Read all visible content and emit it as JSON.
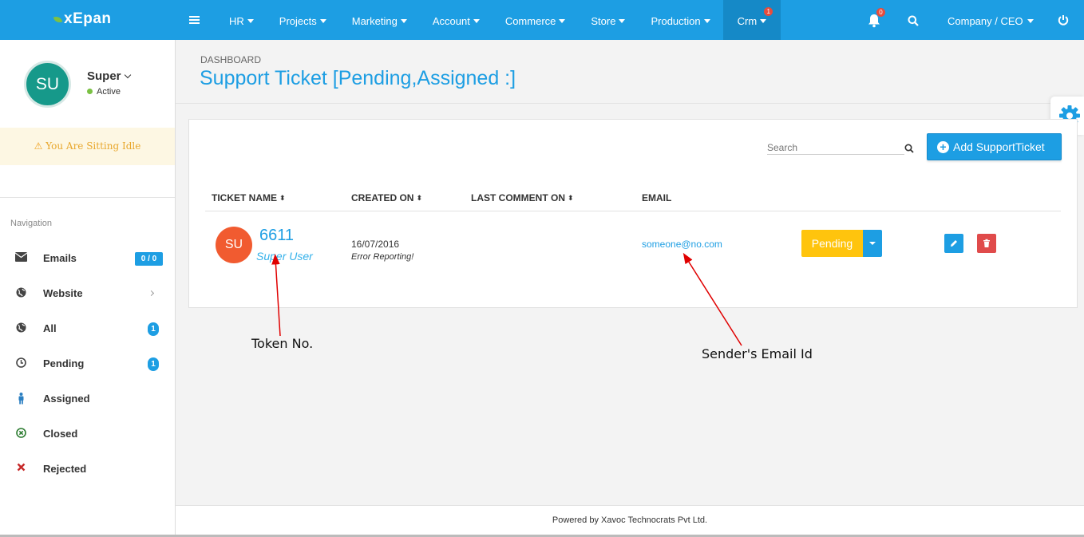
{
  "topbar": {
    "logo": "xEpan",
    "menu": [
      {
        "label": "HR"
      },
      {
        "label": "Projects"
      },
      {
        "label": "Marketing"
      },
      {
        "label": "Account"
      },
      {
        "label": "Commerce"
      },
      {
        "label": "Store"
      },
      {
        "label": "Production"
      },
      {
        "label": "Crm",
        "badge": "1",
        "active": true
      }
    ],
    "notifications_badge": "0",
    "company": "Company / CEO"
  },
  "sidebar": {
    "avatar_initials": "SU",
    "user_name": "Super",
    "user_status": "Active",
    "idle_message": "You Are Sitting Idle",
    "nav_label": "Navigation",
    "items": [
      {
        "label": "Emails",
        "count": "0 / 0",
        "icon": "envelope-icon"
      },
      {
        "label": "Website",
        "icon": "globe-icon"
      },
      {
        "label": "All",
        "count": "1",
        "icon": "globe-icon"
      },
      {
        "label": "Pending",
        "count": "1",
        "icon": "clock-icon"
      },
      {
        "label": "Assigned",
        "icon": "person-icon"
      },
      {
        "label": "Closed",
        "icon": "circle-x-icon"
      },
      {
        "label": "Rejected",
        "icon": "x-icon"
      }
    ]
  },
  "main": {
    "breadcrumb": "DASHBOARD",
    "title": "Support Ticket [Pending,Assigned :]",
    "search_placeholder": "Search",
    "add_button": "Add SupportTicket",
    "columns": [
      "TICKET NAME",
      "CREATED ON",
      "LAST COMMENT ON",
      "EMAIL"
    ],
    "ticket": {
      "avatar": "SU",
      "number": "6611",
      "user": "Super User",
      "created_on": "16/07/2016",
      "subject": "Error Reporting!",
      "email": "someone@no.com",
      "status": "Pending"
    }
  },
  "annotations": {
    "token": "Token No.",
    "email": "Sender's Email Id"
  },
  "footer": "Powered by Xavoc Technocrats Pvt Ltd.",
  "colors": {
    "primary": "#1d9ee3",
    "pending": "#ffc40d",
    "danger": "#e04b4b",
    "avatar_big": "#16998a",
    "avatar_small": "#f15b30"
  }
}
